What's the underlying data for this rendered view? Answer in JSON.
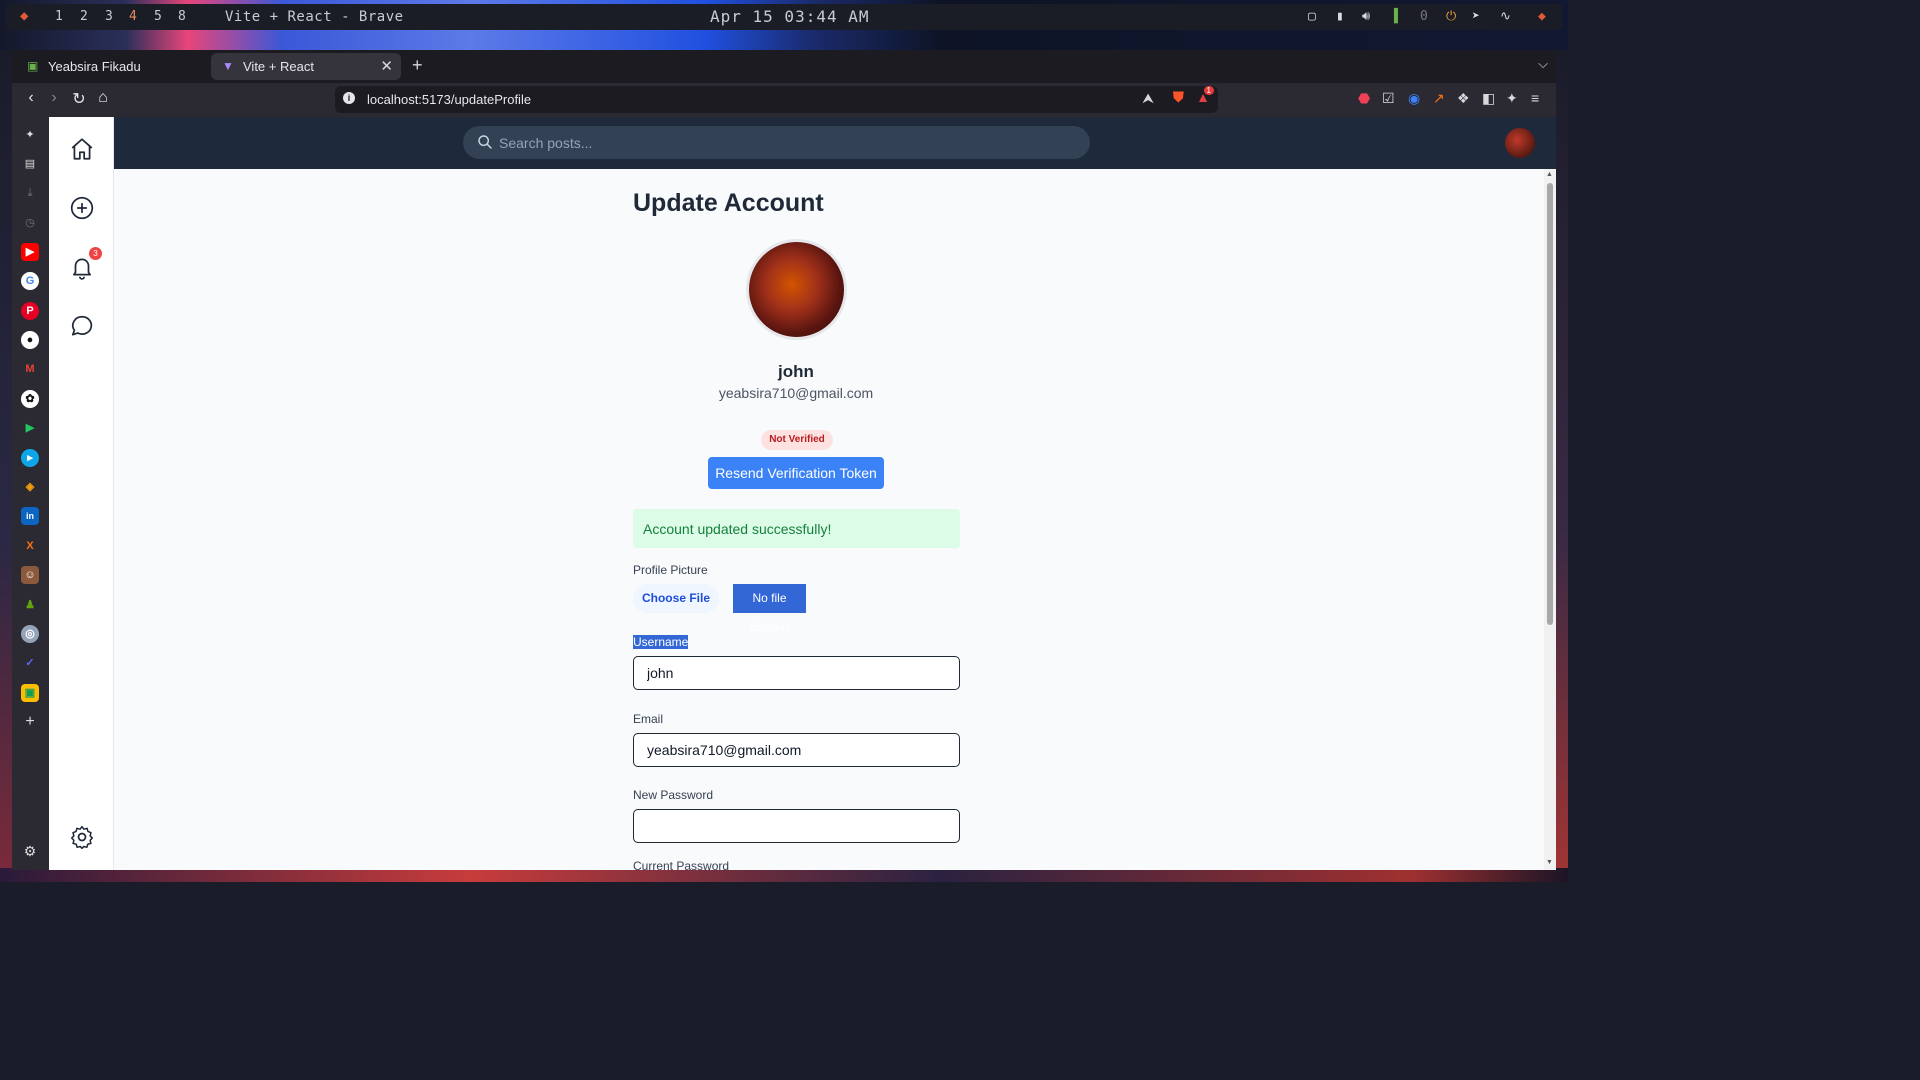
{
  "system_bar": {
    "workspaces": [
      "1",
      "2",
      "3",
      "4",
      "5",
      "8"
    ],
    "window_title": "Vite + React - Brave",
    "clock": "Apr 15 03:44 AM",
    "tray_counter": "0"
  },
  "browser": {
    "tabs": [
      {
        "label": "Yeabsira Fikadu",
        "active": false
      },
      {
        "label": "Vite + React",
        "active": true
      }
    ],
    "url": "localhost:5173/updateProfile",
    "rewards_badge": "1"
  },
  "app": {
    "search_placeholder": "Search posts...",
    "notification_count": "3"
  },
  "profile": {
    "title": "Update Account",
    "username": "john",
    "email": "yeabsira710@gmail.com",
    "verification_status": "Not Verified",
    "resend_button": "Resend Verification Token",
    "success_message": "Account updated successfully!"
  },
  "form": {
    "profile_picture_label": "Profile Picture",
    "choose_file_label": "Choose File",
    "no_file_label": "No file chosen",
    "username_label": "Username",
    "username_value": "john",
    "email_label": "Email",
    "email_value": "yeabsira710@gmail.com",
    "new_password_label": "New Password",
    "new_password_value": "",
    "current_password_label": "Current Password"
  },
  "colors": {
    "header_bg": "#1e293b",
    "primary_button": "#3b82f6",
    "success_bg": "#dcfce7",
    "badge_red": "#ef4444"
  }
}
